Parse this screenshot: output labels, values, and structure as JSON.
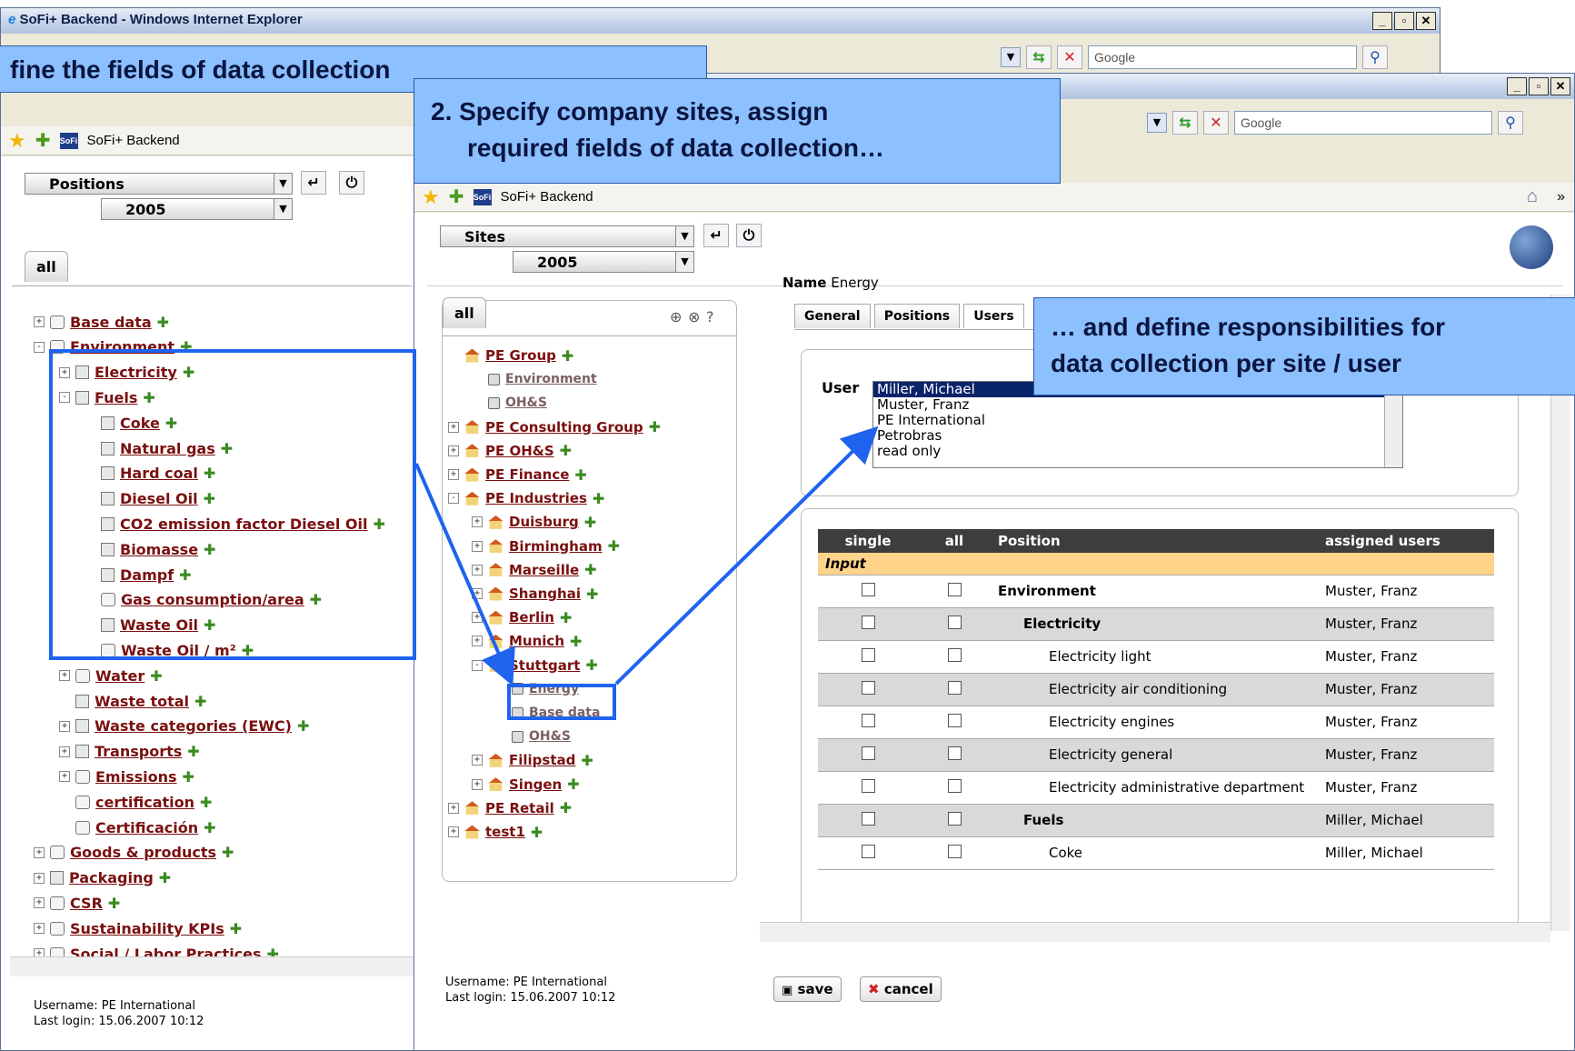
{
  "back_window": {
    "title": "SoFi+ Backend - Windows Internet Explorer",
    "search_placeholder": "Google",
    "tab_label": "SoFi+ Backend",
    "select_view": "Positions",
    "select_year": "2005",
    "tab_all": "all",
    "tree": [
      {
        "label": "Base data",
        "level": 0,
        "expander": "+",
        "icon": "cube"
      },
      {
        "label": "Environment",
        "level": 0,
        "expander": "-",
        "icon": "cube"
      },
      {
        "label": "Electricity",
        "level": 1,
        "expander": "+",
        "icon": "doc"
      },
      {
        "label": "Fuels",
        "level": 1,
        "expander": "-",
        "icon": "doc"
      },
      {
        "label": "Coke",
        "level": 2,
        "expander": "",
        "icon": "doc"
      },
      {
        "label": "Natural gas",
        "level": 2,
        "expander": "",
        "icon": "doc"
      },
      {
        "label": "Hard coal",
        "level": 2,
        "expander": "",
        "icon": "doc"
      },
      {
        "label": "Diesel Oil",
        "level": 2,
        "expander": "",
        "icon": "doc"
      },
      {
        "label": "CO2 emission factor Diesel Oil",
        "level": 2,
        "expander": "",
        "icon": "doc"
      },
      {
        "label": "Biomasse",
        "level": 2,
        "expander": "",
        "icon": "doc"
      },
      {
        "label": "Dampf",
        "level": 2,
        "expander": "",
        "icon": "doc"
      },
      {
        "label": "Gas consumption/area",
        "level": 2,
        "expander": "",
        "icon": "cube"
      },
      {
        "label": "Waste Oil",
        "level": 2,
        "expander": "",
        "icon": "doc"
      },
      {
        "label": "Waste Oil / m²",
        "level": 2,
        "expander": "",
        "icon": "cube"
      },
      {
        "label": "Water",
        "level": 1,
        "expander": "+",
        "icon": "cube"
      },
      {
        "label": "Waste total",
        "level": 1,
        "expander": "",
        "icon": "doc"
      },
      {
        "label": "Waste categories (EWC)",
        "level": 1,
        "expander": "+",
        "icon": "doc"
      },
      {
        "label": "Transports",
        "level": 1,
        "expander": "+",
        "icon": "doc"
      },
      {
        "label": "Emissions",
        "level": 1,
        "expander": "+",
        "icon": "cube"
      },
      {
        "label": "certification",
        "level": 1,
        "expander": "",
        "icon": "cube"
      },
      {
        "label": "Certificación",
        "level": 1,
        "expander": "",
        "icon": "cube"
      },
      {
        "label": "Goods & products",
        "level": 0,
        "expander": "+",
        "icon": "cube"
      },
      {
        "label": "Packaging",
        "level": 0,
        "expander": "+",
        "icon": "doc"
      },
      {
        "label": "CSR",
        "level": 0,
        "expander": "+",
        "icon": "cube"
      },
      {
        "label": "Sustainability KPIs",
        "level": 0,
        "expander": "+",
        "icon": "cube"
      },
      {
        "label": "Social / Labor Practices",
        "level": 0,
        "expander": "+",
        "icon": "cube"
      }
    ],
    "status_username": "Username: PE International",
    "status_login": "Last login: 15.06.2007 10:12"
  },
  "front_window": {
    "search_placeholder": "Google",
    "tab_label": "SoFi+ Backend",
    "select_view": "Sites",
    "select_year": "2005",
    "tab_all": "all",
    "tree": [
      {
        "label": "PE Group",
        "level": 0,
        "expander": "",
        "icon": "house",
        "grey": false
      },
      {
        "label": "Environment",
        "level": 1,
        "expander": "",
        "icon": "box",
        "grey": true
      },
      {
        "label": "OH&S",
        "level": 1,
        "expander": "",
        "icon": "box",
        "grey": true
      },
      {
        "label": "PE Consulting Group",
        "level": 0,
        "expander": "+",
        "icon": "house",
        "grey": false
      },
      {
        "label": "PE OH&S",
        "level": 0,
        "expander": "+",
        "icon": "house",
        "grey": false
      },
      {
        "label": "PE Finance",
        "level": 0,
        "expander": "+",
        "icon": "house",
        "grey": false
      },
      {
        "label": "PE Industries",
        "level": 0,
        "expander": "-",
        "icon": "house",
        "grey": false
      },
      {
        "label": "Duisburg",
        "level": 1,
        "expander": "+",
        "icon": "house",
        "grey": false
      },
      {
        "label": "Birmingham",
        "level": 1,
        "expander": "+",
        "icon": "house",
        "grey": false
      },
      {
        "label": "Marseille",
        "level": 1,
        "expander": "+",
        "icon": "house",
        "grey": false
      },
      {
        "label": "Shanghai",
        "level": 1,
        "expander": "+",
        "icon": "house",
        "grey": false
      },
      {
        "label": "Berlin",
        "level": 1,
        "expander": "+",
        "icon": "house",
        "grey": false
      },
      {
        "label": "Munich",
        "level": 1,
        "expander": "+",
        "icon": "house",
        "grey": false
      },
      {
        "label": "Stuttgart",
        "level": 1,
        "expander": "-",
        "icon": "house",
        "grey": false
      },
      {
        "label": "Energy",
        "level": 2,
        "expander": "",
        "icon": "box",
        "grey": true
      },
      {
        "label": "Base data",
        "level": 2,
        "expander": "",
        "icon": "box",
        "grey": true
      },
      {
        "label": "OH&S",
        "level": 2,
        "expander": "",
        "icon": "box",
        "grey": true
      },
      {
        "label": "Filipstad",
        "level": 1,
        "expander": "+",
        "icon": "house",
        "grey": false
      },
      {
        "label": "Singen",
        "level": 1,
        "expander": "+",
        "icon": "house",
        "grey": false
      },
      {
        "label": "PE Retail",
        "level": 0,
        "expander": "+",
        "icon": "house",
        "grey": false
      },
      {
        "label": "test1",
        "level": 0,
        "expander": "+",
        "icon": "house",
        "grey": false
      }
    ],
    "detail": {
      "name_label": "Name",
      "name_value": "Energy",
      "tabs": [
        "General",
        "Positions",
        "Users"
      ],
      "user_label": "User",
      "users": [
        "Miller, Michael",
        "Muster, Franz",
        "PE International",
        "Petrobras",
        "read only"
      ],
      "selected_user": "Miller, Michael",
      "table_headers": [
        "single",
        "all",
        "Position",
        "assigned users"
      ],
      "input_label": "Input",
      "rows": [
        {
          "position": "Environment",
          "users": "Muster, Franz",
          "indent": 0,
          "bold": true
        },
        {
          "position": "Electricity",
          "users": "Muster, Franz",
          "indent": 1,
          "bold": true
        },
        {
          "position": "Electricity light",
          "users": "Muster, Franz",
          "indent": 2,
          "bold": false
        },
        {
          "position": "Electricity air conditioning",
          "users": "Muster, Franz",
          "indent": 2,
          "bold": false
        },
        {
          "position": "Electricity engines",
          "users": "Muster, Franz",
          "indent": 2,
          "bold": false
        },
        {
          "position": "Electricity general",
          "users": "Muster, Franz",
          "indent": 2,
          "bold": false
        },
        {
          "position": "Electricity administrative department",
          "users": "Muster, Franz",
          "indent": 2,
          "bold": false
        },
        {
          "position": "Fuels",
          "users": "Miller, Michael",
          "indent": 1,
          "bold": true
        },
        {
          "position": "Coke",
          "users": "Miller, Michael",
          "indent": 2,
          "bold": false
        }
      ],
      "save_label": "save",
      "cancel_label": "cancel"
    },
    "status_username": "Username: PE International",
    "status_login": "Last login: 15.06.2007 10:12"
  },
  "callouts": {
    "step1": "fine the fields of data collection",
    "step2_line1": "2. Specify company sites, assign",
    "step2_line2": "required fields of data collection…",
    "step3_line1": "… and define responsibilities for",
    "step3_line2": "data collection per site / user"
  },
  "colors": {
    "callout_fill": "#8cc0ff",
    "highlight": "#1f63ef",
    "link": "#7a1010",
    "input_row": "#ffd38a"
  }
}
